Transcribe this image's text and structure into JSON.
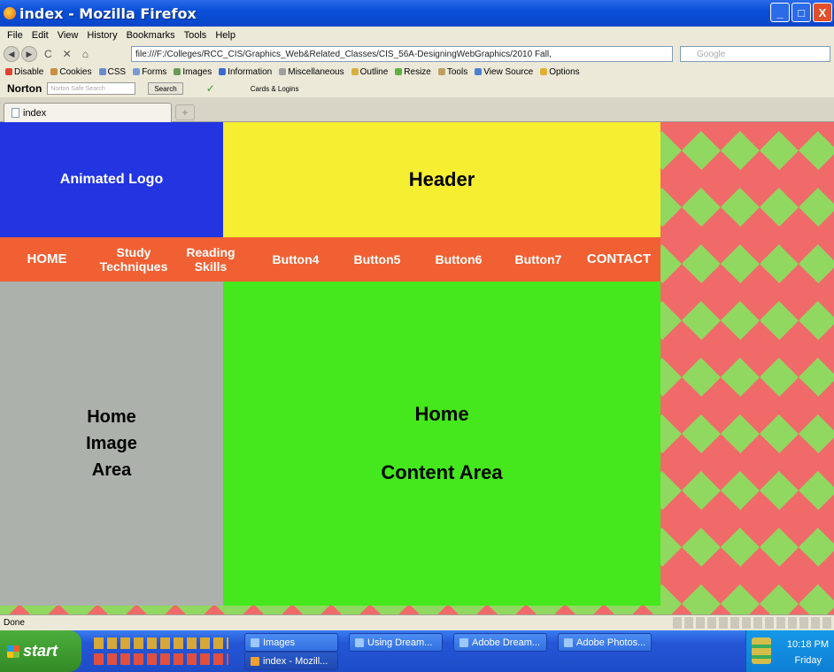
{
  "window": {
    "title": "index - Mozilla Firefox",
    "buttons": {
      "minimize": "_",
      "maximize": "□",
      "close": "X"
    }
  },
  "menu": [
    "File",
    "Edit",
    "View",
    "History",
    "Bookmarks",
    "Tools",
    "Help"
  ],
  "nav": {
    "url": "file:///F:/Colleges/RCC_CIS/Graphics_Web&Related_Classes/CIS_56A-DesigningWebGraphics/2010 Fall,",
    "search_placeholder": "Google"
  },
  "dev_toolbar": [
    "Disable",
    "Cookies",
    "CSS",
    "Forms",
    "Images",
    "Information",
    "Miscellaneous",
    "Outline",
    "Resize",
    "Tools",
    "View Source",
    "Options"
  ],
  "norton": {
    "brand": "Norton",
    "search_placeholder": "Norton Safe Search",
    "search_button": "Search",
    "cards": "Cards & Logins"
  },
  "tab": {
    "label": "index",
    "new_tab": "+"
  },
  "page": {
    "logo": "Animated Logo",
    "header": "Header",
    "nav_items": [
      {
        "label": "HOME"
      },
      {
        "label": "Study Techniques"
      },
      {
        "label": "Reading Skills"
      },
      {
        "label": "Button4"
      },
      {
        "label": "Button5"
      },
      {
        "label": "Button6"
      },
      {
        "label": "Button7"
      },
      {
        "label": "CONTACT"
      }
    ],
    "image_area": "Home Image Area",
    "content_title": "Home",
    "content_subtitle": "Content Area",
    "colors": {
      "logo": "#2235e0",
      "header": "#f6ee31",
      "nav": "#f06032",
      "image_area": "#acb1ac",
      "content": "#44e81c",
      "diamond_red": "#f06a6a",
      "diamond_green": "#90d860"
    }
  },
  "status": {
    "text": "Done"
  },
  "taskbar": {
    "start": "start",
    "buttons": [
      "Images",
      "Using Dream...",
      "Adobe Dream...",
      "Adobe Photos...",
      "index - Mozill..."
    ],
    "clock": "10:18 PM",
    "day": "Friday"
  }
}
